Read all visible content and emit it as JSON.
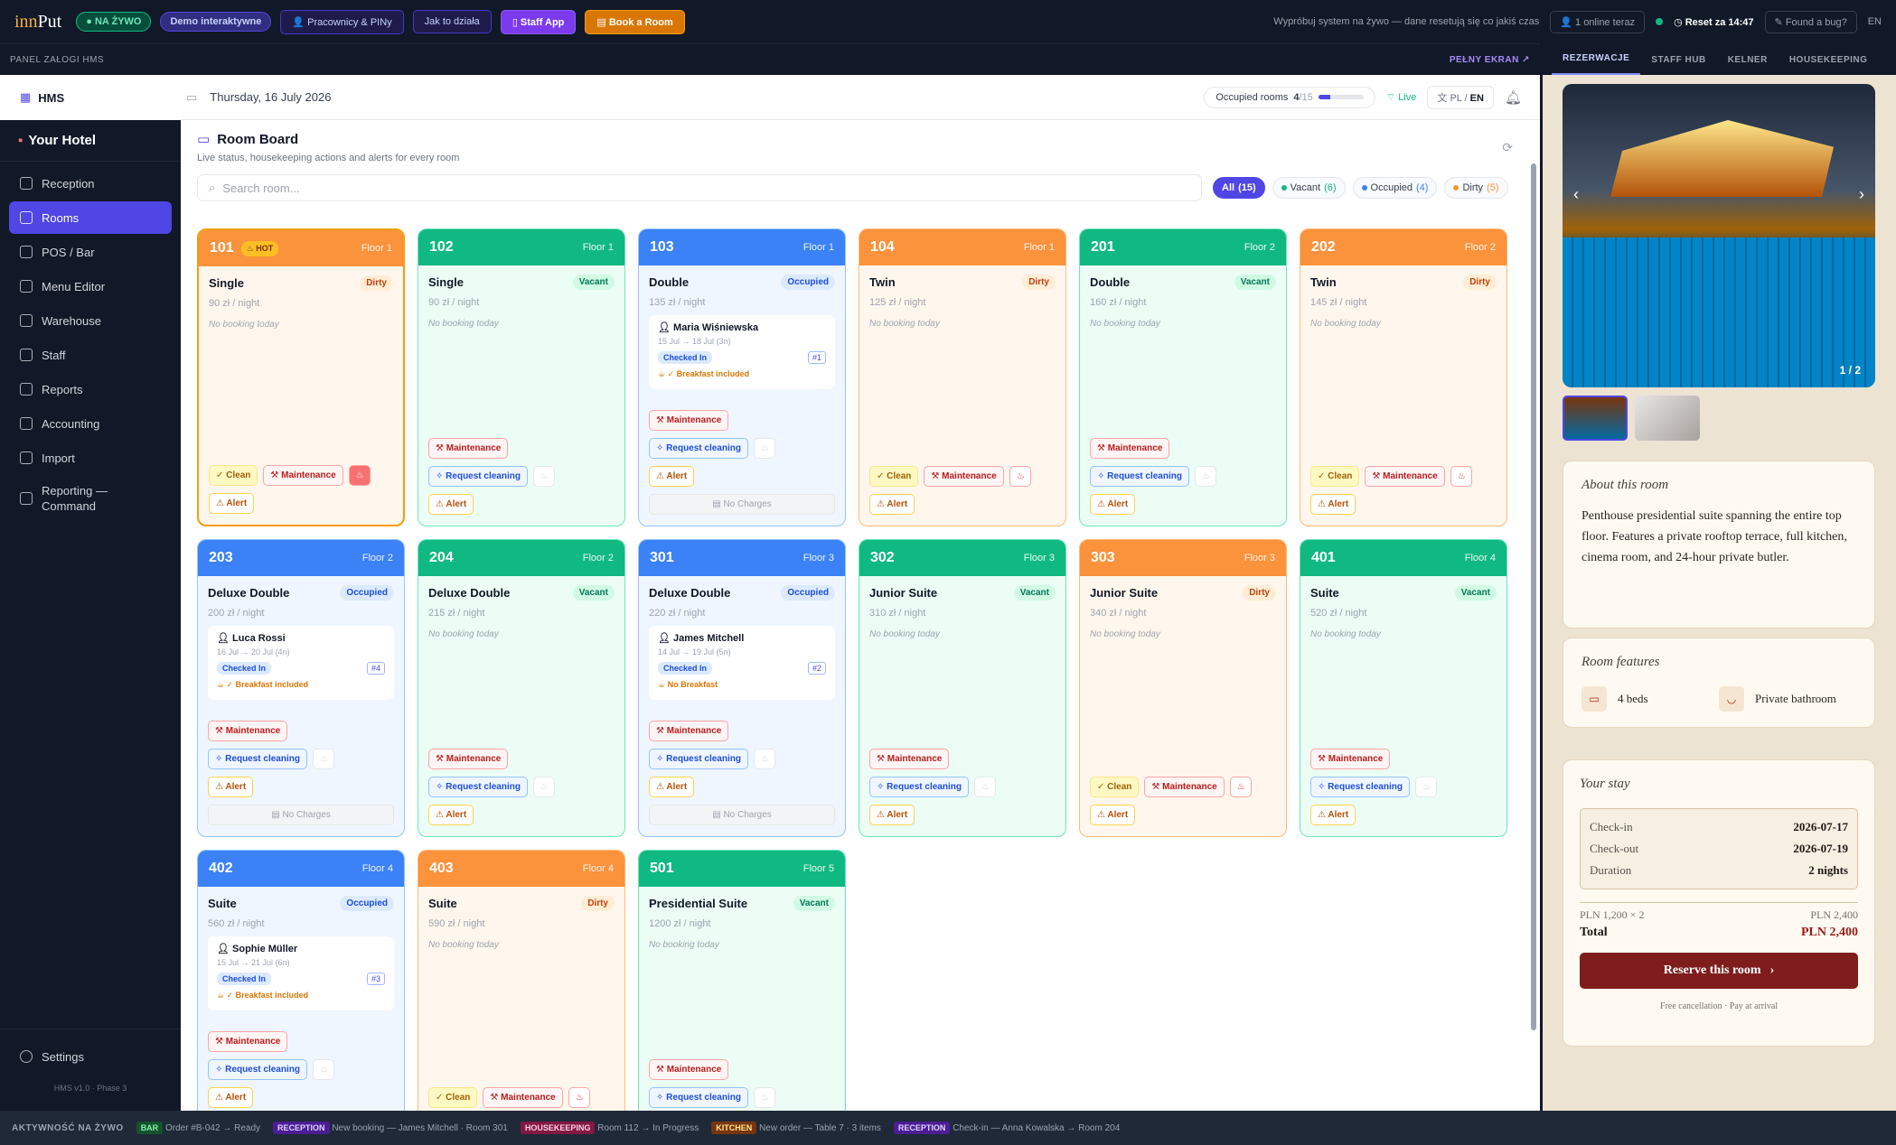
{
  "topbar": {
    "logo_pre": "inn",
    "logo_post": "Put",
    "live_label": "NA ŻYWO",
    "demo_label": "Demo interaktywne",
    "buttons": [
      "Pracownicy & PINy",
      "Jak to działa",
      "Staff App",
      "Book a Room"
    ],
    "notice": "Wypróbuj system na żywo — dane resetują się co jakiś czas",
    "online": "1 online teraz",
    "reset": "Reset za 14:47",
    "bug": "Found a bug?",
    "overflow": "EN"
  },
  "panel": {
    "label": "PANEL ZAŁOGI HMS",
    "fullscreen": "PEŁNY EKRAN ↗"
  },
  "sidebar": {
    "app": "HMS",
    "hotel": "Your Hotel",
    "items": [
      "Reception",
      "Rooms",
      "POS / Bar",
      "Menu Editor",
      "Warehouse",
      "Staff",
      "Reports",
      "Accounting",
      "Import",
      "Reporting — Command"
    ],
    "active_index": 1,
    "settings": "Settings",
    "version": "HMS v1.0 · Phase 3"
  },
  "header": {
    "date": "Thursday, 16 July 2026",
    "occupied_label": "Occupied rooms",
    "occupied_value": "4",
    "occupied_total": "/15",
    "occupied_fraction": 0.27,
    "live": "Live",
    "lang_pl": "PL",
    "lang_sep": "/",
    "lang_en": "EN"
  },
  "board": {
    "title": "Room Board",
    "subtitle": "Live status, housekeeping actions and alerts for every room",
    "search_placeholder": "Search room...",
    "filters": [
      {
        "label": "All",
        "count": "(15)",
        "color": ""
      },
      {
        "label": "Vacant",
        "count": "(6)",
        "color": "#10b981"
      },
      {
        "label": "Occupied",
        "count": "(4)",
        "color": "#3b82f6"
      },
      {
        "label": "Dirty",
        "count": "(5)",
        "color": "#fb923c"
      }
    ]
  },
  "labels": {
    "no_booking": "No booking today",
    "clean": "Clean",
    "maintenance": "Maintenance",
    "request_cleaning": "Request cleaning",
    "alert": "Alert",
    "no_charges": "No Charges",
    "hot": "HOT"
  },
  "rooms": [
    {
      "num": "101",
      "floor": "Floor 1",
      "type": "Single",
      "status": "Dirty",
      "price": "90 zł / night",
      "hot": true
    },
    {
      "num": "102",
      "floor": "Floor 1",
      "type": "Single",
      "status": "Vacant",
      "price": "90 zł / night"
    },
    {
      "num": "103",
      "floor": "Floor 1",
      "type": "Double",
      "status": "Occupied",
      "price": "135 zł / night",
      "guest": {
        "name": "Maria Wiśniewska",
        "dates": "15 Jul → 18 Jul",
        "nights": "(3n)",
        "state": "Checked In",
        "id": "#1",
        "breakfast": "✓ Breakfast included"
      }
    },
    {
      "num": "104",
      "floor": "Floor 1",
      "type": "Twin",
      "status": "Dirty",
      "price": "125 zł / night"
    },
    {
      "num": "201",
      "floor": "Floor 2",
      "type": "Double",
      "status": "Vacant",
      "price": "160 zł / night"
    },
    {
      "num": "202",
      "floor": "Floor 2",
      "type": "Twin",
      "status": "Dirty",
      "price": "145 zł / night"
    },
    {
      "num": "203",
      "floor": "Floor 2",
      "type": "Deluxe Double",
      "status": "Occupied",
      "price": "200 zł / night",
      "guest": {
        "name": "Luca Rossi",
        "dates": "16 Jul → 20 Jul",
        "nights": "(4n)",
        "state": "Checked In",
        "id": "#4",
        "breakfast": "✓ Breakfast included"
      }
    },
    {
      "num": "204",
      "floor": "Floor 2",
      "type": "Deluxe Double",
      "status": "Vacant",
      "price": "215 zł / night"
    },
    {
      "num": "301",
      "floor": "Floor 3",
      "type": "Deluxe Double",
      "status": "Occupied",
      "price": "220 zł / night",
      "guest": {
        "name": "James Mitchell",
        "dates": "14 Jul → 19 Jul",
        "nights": "(5n)",
        "state": "Checked In",
        "id": "#2",
        "breakfast": "No Breakfast"
      }
    },
    {
      "num": "302",
      "floor": "Floor 3",
      "type": "Junior Suite",
      "status": "Vacant",
      "price": "310 zł / night"
    },
    {
      "num": "303",
      "floor": "Floor 3",
      "type": "Junior Suite",
      "status": "Dirty",
      "price": "340 zł / night"
    },
    {
      "num": "401",
      "floor": "Floor 4",
      "type": "Suite",
      "status": "Vacant",
      "price": "520 zł / night"
    },
    {
      "num": "402",
      "floor": "Floor 4",
      "type": "Suite",
      "status": "Occupied",
      "price": "560 zł / night",
      "guest": {
        "name": "Sophie Müller",
        "dates": "15 Jul → 21 Jul",
        "nights": "(6n)",
        "state": "Checked In",
        "id": "#3",
        "breakfast": "✓ Breakfast included"
      }
    },
    {
      "num": "403",
      "floor": "Floor 4",
      "type": "Suite",
      "status": "Dirty",
      "price": "590 zł / night"
    },
    {
      "num": "501",
      "floor": "Floor 5",
      "type": "Presidential Suite",
      "status": "Vacant",
      "price": "1200 zł / night"
    }
  ],
  "right": {
    "tabs": [
      "REZERWACJE",
      "STAFF HUB",
      "KELNER",
      "HOUSEKEEPING"
    ],
    "photo_counter": "1 / 2",
    "about_title": "About this room",
    "about_text": "Penthouse presidential suite spanning the entire top floor. Features a private rooftop terrace, full kitchen, cinema room, and 24-hour private butler.",
    "features_title": "Room features",
    "features": [
      "4 beds",
      "Private bathroom"
    ],
    "stay_title": "Your stay",
    "checkin_label": "Check-in",
    "checkin": "2026-07-17",
    "checkout_label": "Check-out",
    "checkout": "2026-07-19",
    "duration_label": "Duration",
    "duration": "2 nights",
    "calc_label": "PLN 1,200 × 2",
    "calc_value": "PLN 2,400",
    "total_label": "Total",
    "total_value": "PLN 2,400",
    "reserve": "Reserve this room",
    "free_note": "Free cancellation · Pay at arrival"
  },
  "footer": {
    "label": "AKTYWNOŚĆ NA ŻYWO",
    "events": [
      {
        "tag": "BAR",
        "text": "Order #B-042 → Ready"
      },
      {
        "tag": "RECEPTION",
        "text": "New booking — James Mitchell · Room 301"
      },
      {
        "tag": "HOUSEKEEPING",
        "text": "Room 112 → In Progress"
      },
      {
        "tag": "KITCHEN",
        "text": "New order — Table 7 · 3 items"
      },
      {
        "tag": "RECEPTION",
        "text": "Check-in — Anna Kowalska → Room 204"
      }
    ]
  }
}
